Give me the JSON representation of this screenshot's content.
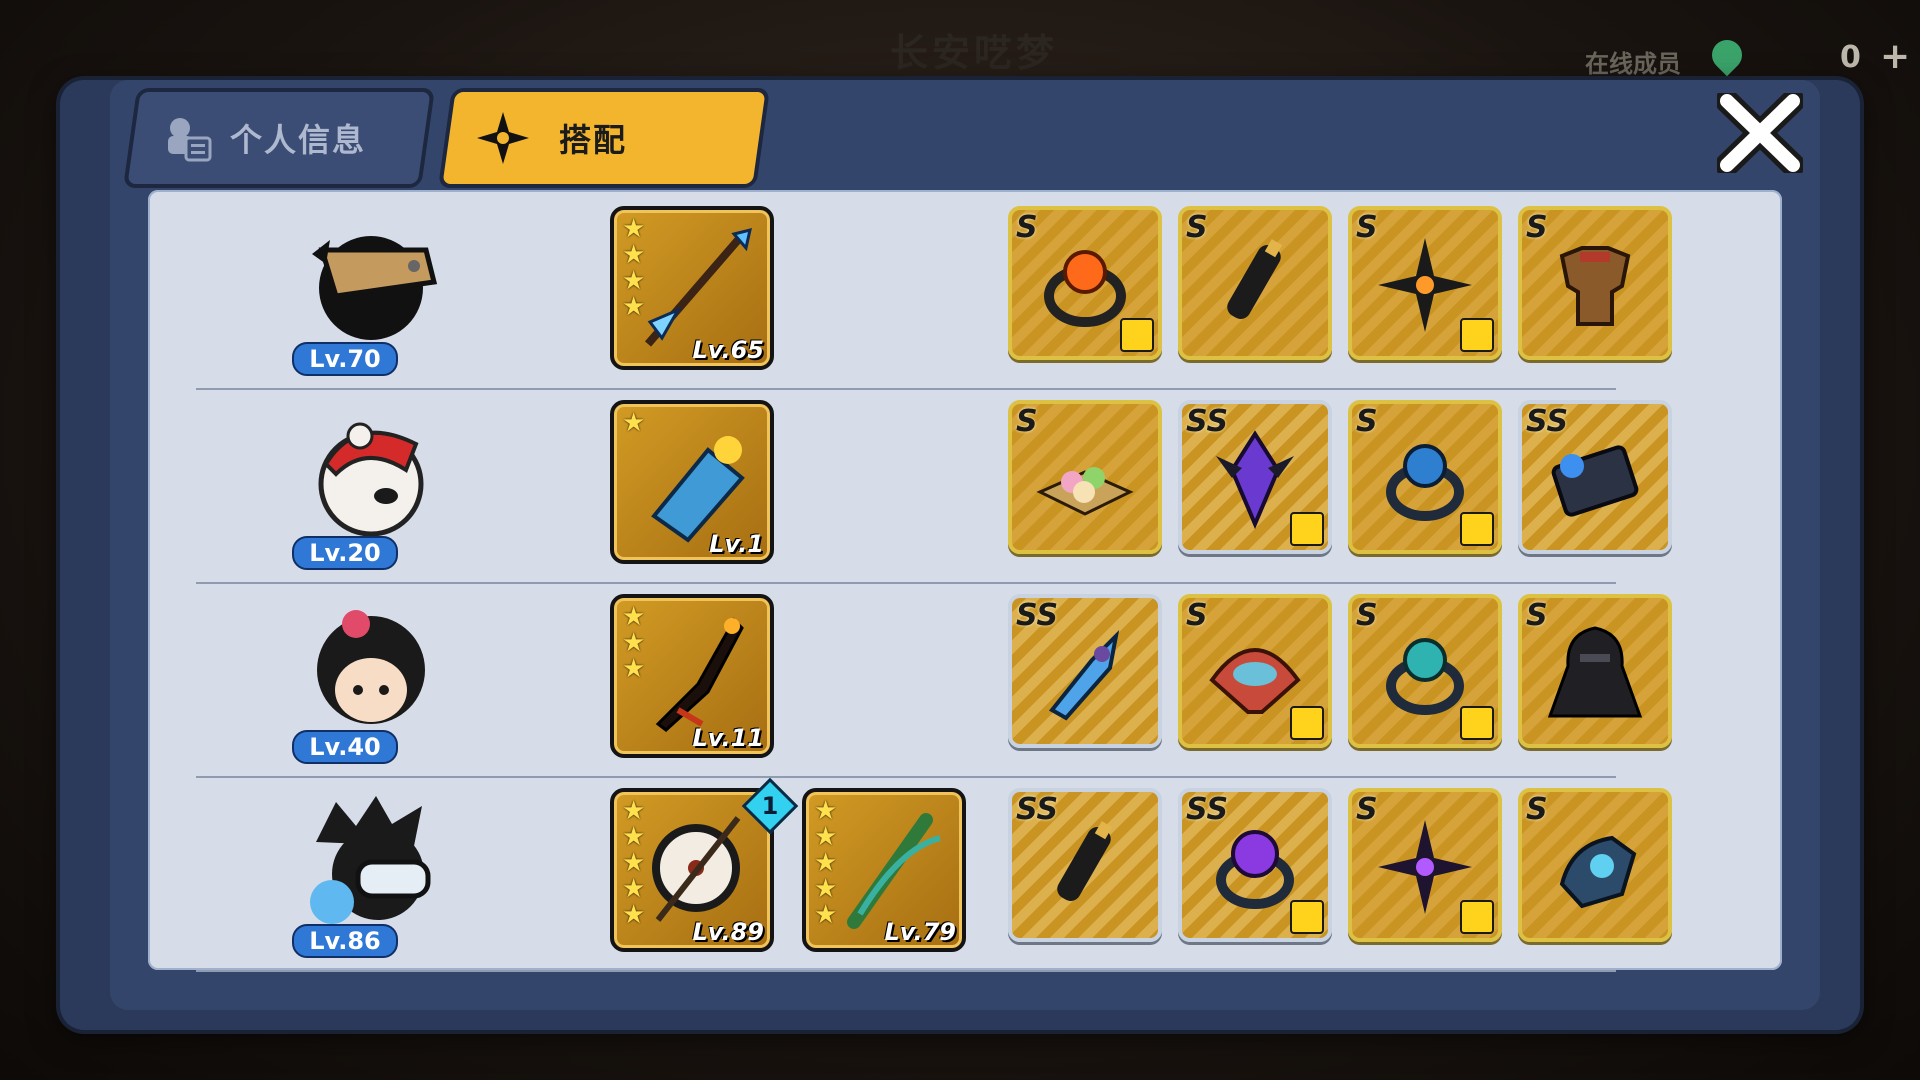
{
  "background": {
    "title": "长安呓梦",
    "online_label": "在线成员",
    "online_count": "0",
    "plus_symbol": "+"
  },
  "tabs": [
    {
      "label": "个人信息",
      "active": false
    },
    {
      "label": "搭配",
      "active": true
    }
  ],
  "close_icon": "close-x-icon",
  "colors": {
    "active_tab": "#f3b52e",
    "inactive_tab": "#3b4d74",
    "panel": "#d6dde9",
    "level_badge": "#2f78d6"
  },
  "rows": [
    {
      "level": "Lv.70",
      "avatar_icon": "masked-ninja-avatar-icon",
      "weapons": [
        {
          "level": "Lv.65",
          "stars": 4,
          "icon": "blue-spear-icon"
        }
      ],
      "equipment": [
        {
          "grade": "S",
          "icon": "fire-ring-icon",
          "shirt": true
        },
        {
          "grade": "S",
          "icon": "scroll-icon",
          "shirt": false
        },
        {
          "grade": "S",
          "icon": "shuriken-icon",
          "shirt": true
        },
        {
          "grade": "S",
          "icon": "armor-icon",
          "shirt": false
        }
      ]
    },
    {
      "level": "Lv.20",
      "avatar_icon": "panda-hat-avatar-icon",
      "weapons": [
        {
          "level": "Lv.1",
          "stars": 1,
          "icon": "shark-cannon-icon"
        }
      ],
      "equipment": [
        {
          "grade": "S",
          "icon": "dango-plate-icon",
          "shirt": false
        },
        {
          "grade": "SS",
          "icon": "purple-crystal-icon",
          "shirt": true
        },
        {
          "grade": "S",
          "icon": "blue-ring-icon",
          "shirt": true
        },
        {
          "grade": "SS",
          "icon": "cursed-scroll-icon",
          "shirt": false
        }
      ]
    },
    {
      "level": "Lv.40",
      "avatar_icon": "red-flower-girl-avatar-icon",
      "weapons": [
        {
          "level": "Lv.11",
          "stars": 3,
          "icon": "dark-blade-icon"
        }
      ],
      "equipment": [
        {
          "grade": "SS",
          "icon": "blue-kunai-icon",
          "shirt": false
        },
        {
          "grade": "S",
          "icon": "fish-fan-icon",
          "shirt": true
        },
        {
          "grade": "S",
          "icon": "ice-ring-icon",
          "shirt": true
        },
        {
          "grade": "S",
          "icon": "hood-armor-icon",
          "shirt": false
        }
      ]
    },
    {
      "level": "Lv.86",
      "avatar_icon": "goggles-ninja-avatar-icon",
      "weapons": [
        {
          "level": "Lv.89",
          "stars": 5,
          "icon": "drum-staff-icon",
          "badge": "1"
        },
        {
          "level": "Lv.79",
          "stars": 5,
          "icon": "bamboo-flute-icon"
        }
      ],
      "equipment": [
        {
          "grade": "SS",
          "icon": "scroll-icon",
          "shirt": false
        },
        {
          "grade": "SS",
          "icon": "purple-ring-icon",
          "shirt": true
        },
        {
          "grade": "S",
          "icon": "purple-shuriken-icon",
          "shirt": true
        },
        {
          "grade": "S",
          "icon": "spirit-glove-icon",
          "shirt": false
        }
      ]
    }
  ]
}
